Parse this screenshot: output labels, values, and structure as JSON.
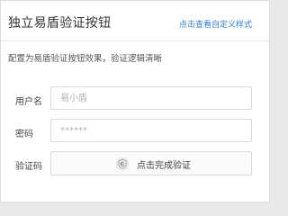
{
  "header": {
    "title": "独立易盾验证按钮",
    "custom_style_link": "点击查看自定义样式"
  },
  "description": "配置为易盾验证按钮效果，验证逻辑清晰",
  "form": {
    "username": {
      "label": "用户名",
      "placeholder": "易小盾",
      "value": ""
    },
    "password": {
      "label": "密码",
      "placeholder": "******",
      "value": ""
    },
    "captcha": {
      "label": "验证码",
      "button_text": "点击完成验证",
      "icon": "netease-yidun-shield-icon"
    }
  },
  "colors": {
    "link": "#2f7fd8",
    "text": "#333333",
    "border": "#dadada",
    "placeholder": "#b0b0b0"
  }
}
